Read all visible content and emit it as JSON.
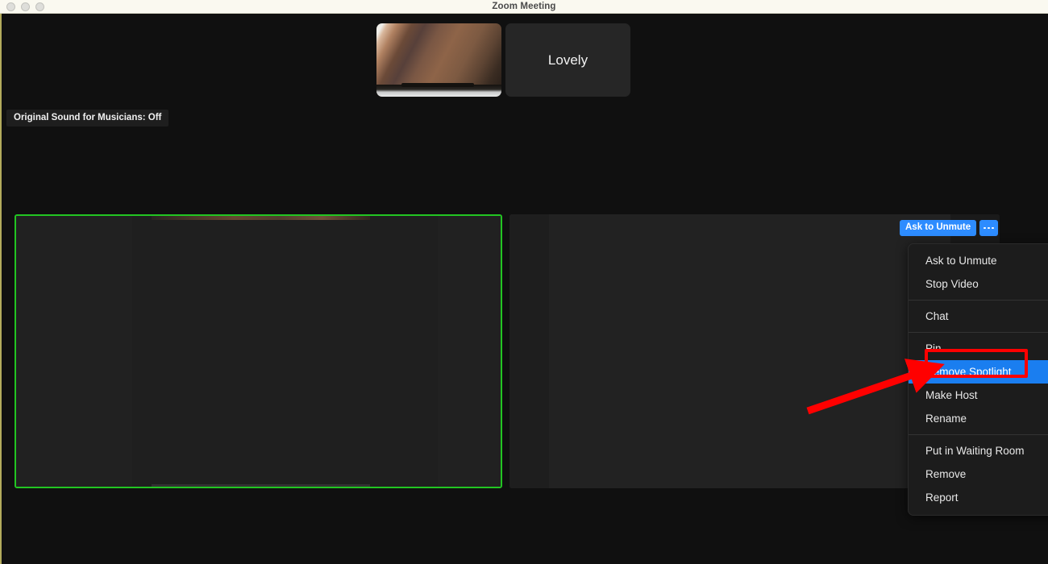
{
  "window": {
    "title": "Zoom Meeting",
    "traffic_lights": [
      "close-button",
      "minimize-button",
      "maximize-button"
    ]
  },
  "thumbnails": [
    {
      "type": "video",
      "name": "",
      "icon": "video-thumbnail"
    },
    {
      "type": "name",
      "name": "Lovely",
      "icon": "participant-tile"
    }
  ],
  "banner": {
    "original_sound": "Original Sound for Musicians: Off"
  },
  "tiles": {
    "spotlight": {
      "label": "",
      "border_color": "#22c522",
      "state": "spotlighted"
    },
    "secondary": {
      "label": "",
      "state": "video"
    }
  },
  "participant_controls": {
    "ask_to_unmute": "Ask to Unmute",
    "more_icon": "ellipsis-icon",
    "accent_color": "#2d8cff"
  },
  "context_menu": {
    "selected": "Remove Spotlight",
    "highlight_color": "#1a7ef0",
    "groups": [
      {
        "items": [
          "Ask to Unmute",
          "Stop Video"
        ]
      },
      {
        "items": [
          "Chat"
        ]
      },
      {
        "items": [
          "Pin",
          "Remove Spotlight",
          "Make Host",
          "Rename"
        ]
      },
      {
        "items": [
          "Put in Waiting Room",
          "Remove",
          "Report"
        ]
      }
    ]
  },
  "annotations": {
    "highlight_box_color": "#ff0000",
    "arrow_color": "#ff0000",
    "arrow_target": "Remove Spotlight"
  }
}
